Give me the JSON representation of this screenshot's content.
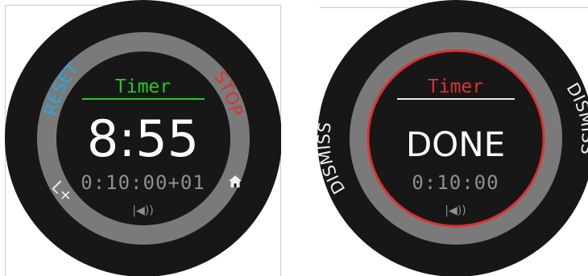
{
  "left_watch": {
    "title": "Timer",
    "main_value": "8:55",
    "sub_value": "0:10:00+01",
    "left_arc_label": "RESET",
    "right_arc_label": "STOP",
    "bottom_left_label": "L+",
    "bottom_right_icon": "home-icon",
    "sound_icon": "speaker-icon",
    "colors": {
      "title": "#22cc22",
      "reset": "#28a8e0",
      "stop": "#e03030"
    }
  },
  "right_watch": {
    "title": "Timer",
    "main_value": "DONE",
    "sub_value": "0:10:00",
    "left_arc_label": "DISMISS",
    "right_arc_label": "DISMISS",
    "sound_icon": "speaker-icon",
    "colors": {
      "title": "#e03030",
      "ring": "#e03030"
    }
  }
}
